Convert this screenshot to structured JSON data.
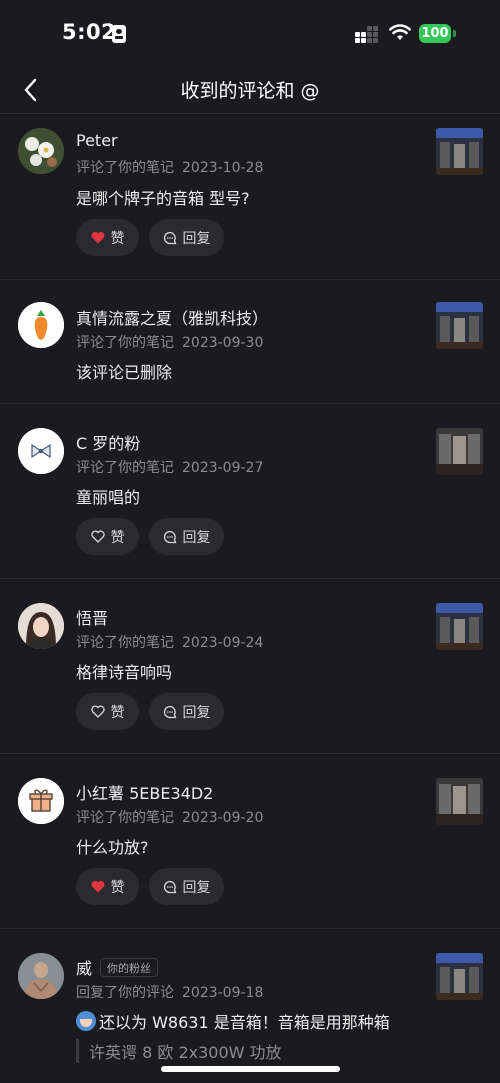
{
  "status": {
    "time": "5:02",
    "battery": "100"
  },
  "header": {
    "title": "收到的评论和 @"
  },
  "items": [
    {
      "user": "Peter",
      "action": "评论了你的笔记",
      "date": "2023-10-28",
      "text": "是哪个牌子的音箱 型号?",
      "like": "赞",
      "liked": true,
      "reply": "回复"
    },
    {
      "user": "真情流露之夏（雅凯科技）",
      "action": "评论了你的笔记",
      "date": "2023-09-30",
      "text": "该评论已删除"
    },
    {
      "user": "C 罗的粉",
      "action": "评论了你的笔记",
      "date": "2023-09-27",
      "text": "童丽唱的",
      "like": "赞",
      "liked": false,
      "reply": "回复"
    },
    {
      "user": "悟晋",
      "action": "评论了你的笔记",
      "date": "2023-09-24",
      "text": "格律诗音响吗",
      "like": "赞",
      "liked": false,
      "reply": "回复"
    },
    {
      "user": "小红薯 5EBE34D2",
      "action": "评论了你的笔记",
      "date": "2023-09-20",
      "text": "什么功放?",
      "like": "赞",
      "liked": true,
      "reply": "回复"
    },
    {
      "user": "威",
      "badge": "你的粉丝",
      "action": "回复了你的评论",
      "date": "2023-09-18",
      "text": "还以为 W8631 是音箱！音箱是用那种箱",
      "quote": "许英谔 8 欧 2x300W 功放"
    }
  ],
  "colors": {
    "background": "#1b1b1f",
    "like_red": "#e0353f",
    "battery_green": "#35c759"
  }
}
